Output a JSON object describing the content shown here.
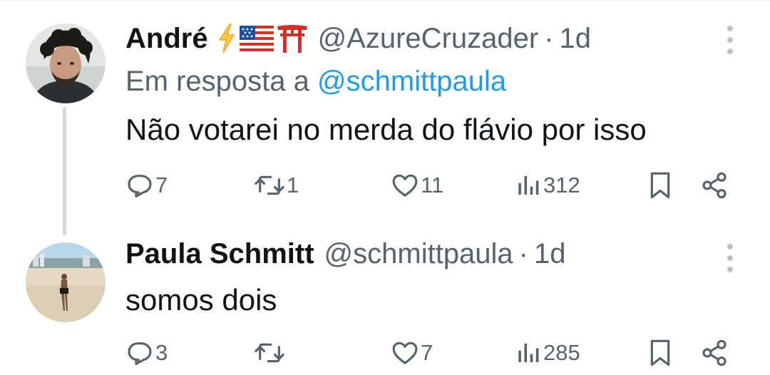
{
  "tweets": [
    {
      "name": "André",
      "emojis": [
        "⚡",
        "🇺🇸",
        "⛩"
      ],
      "handle": "@AzureCruzader",
      "separator": "·",
      "time": "1d",
      "reply_prefix": "Em resposta a",
      "reply_handle": "@schmittpaula",
      "text": "Não votarei no merda do flávio por isso",
      "replies": "7",
      "retweets": "1",
      "likes": "11",
      "views": "312"
    },
    {
      "name": "Paula Schmitt",
      "handle": "@schmittpaula",
      "separator": "·",
      "time": "1d",
      "text": "somos dois",
      "replies": "3",
      "retweets": "",
      "likes": "7",
      "views": "285"
    }
  ],
  "colors": {
    "text": "#0f1419",
    "secondary": "#536471",
    "link": "#1d9bf0",
    "thread_line": "#cfd9de"
  },
  "icons": [
    "reply-icon",
    "retweet-icon",
    "like-icon",
    "views-icon",
    "bookmark-icon",
    "share-icon",
    "more-options-icon"
  ]
}
